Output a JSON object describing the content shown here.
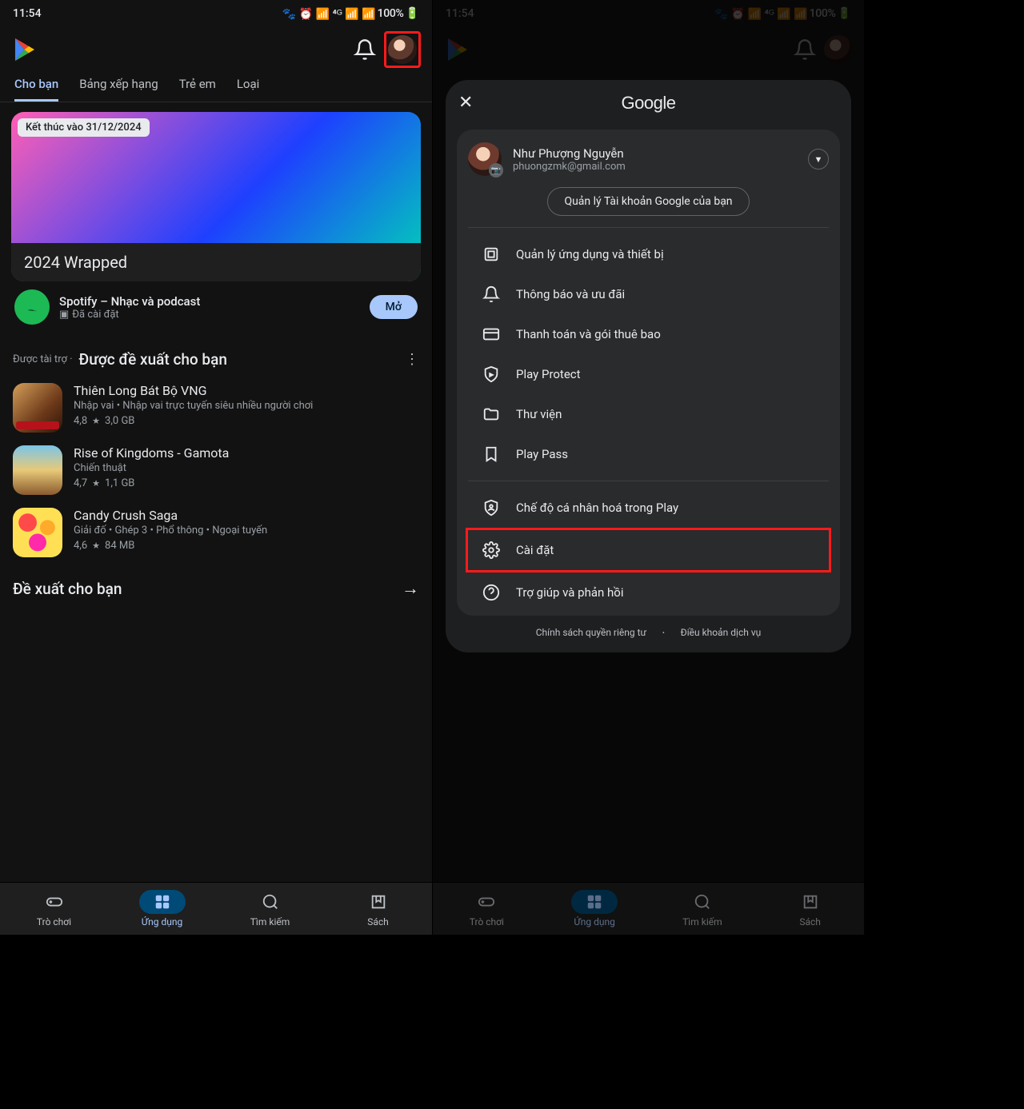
{
  "status": {
    "time": "11:54",
    "battery": "100%"
  },
  "tabs": {
    "t1": "Cho bạn",
    "t2": "Bảng xếp hạng",
    "t3": "Trẻ em",
    "t4": "Loại"
  },
  "promo": {
    "badge": "Kết thúc vào 31/12/2024",
    "title": "2024 Wrapped"
  },
  "featured": {
    "name": "Spotify – Nhạc và podcast",
    "status": "Đã cài đặt",
    "open": "Mở"
  },
  "section1": {
    "sponsored": "Được tài trợ ·",
    "title": "Được đề xuất cho bạn"
  },
  "apps": [
    {
      "name": "Thiên Long Bát Bộ VNG",
      "tags": "Nhập vai • Nhập vai trực tuyến siêu nhiều người chơi",
      "rating": "4,8",
      "size": "3,0 GB"
    },
    {
      "name": "Rise of Kingdoms - Gamota",
      "tags": "Chiến thuật",
      "rating": "4,7",
      "size": "1,1 GB"
    },
    {
      "name": "Candy Crush Saga",
      "tags": "Giải đố • Ghép 3 • Phổ thông • Ngoại tuyến",
      "rating": "4,6",
      "size": "84 MB"
    }
  ],
  "section2": {
    "title": "Đề xuất cho bạn"
  },
  "nav": {
    "games": "Trò chơi",
    "apps": "Ứng dụng",
    "search": "Tìm kiếm",
    "books": "Sách"
  },
  "sheet": {
    "brand": "Google",
    "account": {
      "name": "Như Phượng Nguyễn",
      "email": "phuongzmk@gmail.com"
    },
    "manage": "Quản lý Tài khoản Google của bạn",
    "items": [
      "Quản lý ứng dụng và thiết bị",
      "Thông báo và ưu đãi",
      "Thanh toán và gói thuê bao",
      "Play Protect",
      "Thư viện",
      "Play Pass",
      "Chế độ cá nhân hoá trong Play",
      "Cài đặt",
      "Trợ giúp và phản hồi"
    ],
    "footer": {
      "privacy": "Chính sách quyền riêng tư",
      "terms": "Điều khoản dịch vụ"
    }
  }
}
